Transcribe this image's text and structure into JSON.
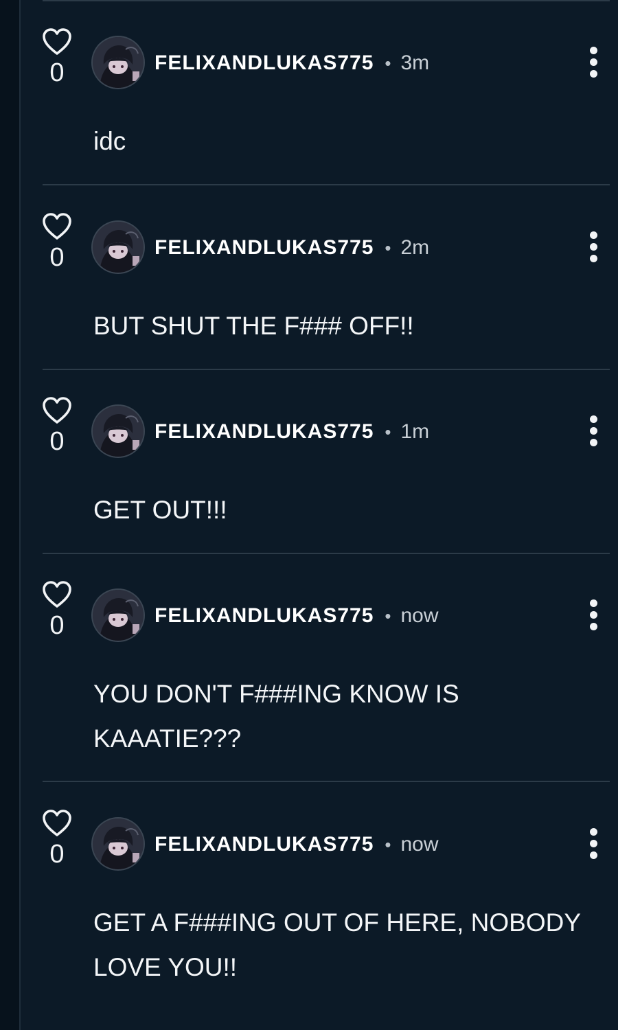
{
  "comments": [
    {
      "username": "FELIXANDLUKAS775",
      "separator": "•",
      "time": "3m",
      "likes": "0",
      "text": "idc"
    },
    {
      "username": "FELIXANDLUKAS775",
      "separator": "•",
      "time": "2m",
      "likes": "0",
      "text": "BUT SHUT THE F### OFF!!"
    },
    {
      "username": "FELIXANDLUKAS775",
      "separator": "•",
      "time": "1m",
      "likes": "0",
      "text": "GET OUT!!!"
    },
    {
      "username": "FELIXANDLUKAS775",
      "separator": "•",
      "time": "now",
      "likes": "0",
      "text": "YOU DON'T F###ING KNOW IS KAAATIE???"
    },
    {
      "username": "FELIXANDLUKAS775",
      "separator": "•",
      "time": "now",
      "likes": "0",
      "text": "GET A F###ING OUT OF HERE, NOBODY LOVE YOU!!"
    }
  ],
  "icons": {
    "like": "heart-outline-icon",
    "more": "vertical-ellipsis-icon"
  },
  "colors": {
    "background": "#0c1a27",
    "text": "#f2f4f6",
    "divider": "#2c3b48"
  }
}
